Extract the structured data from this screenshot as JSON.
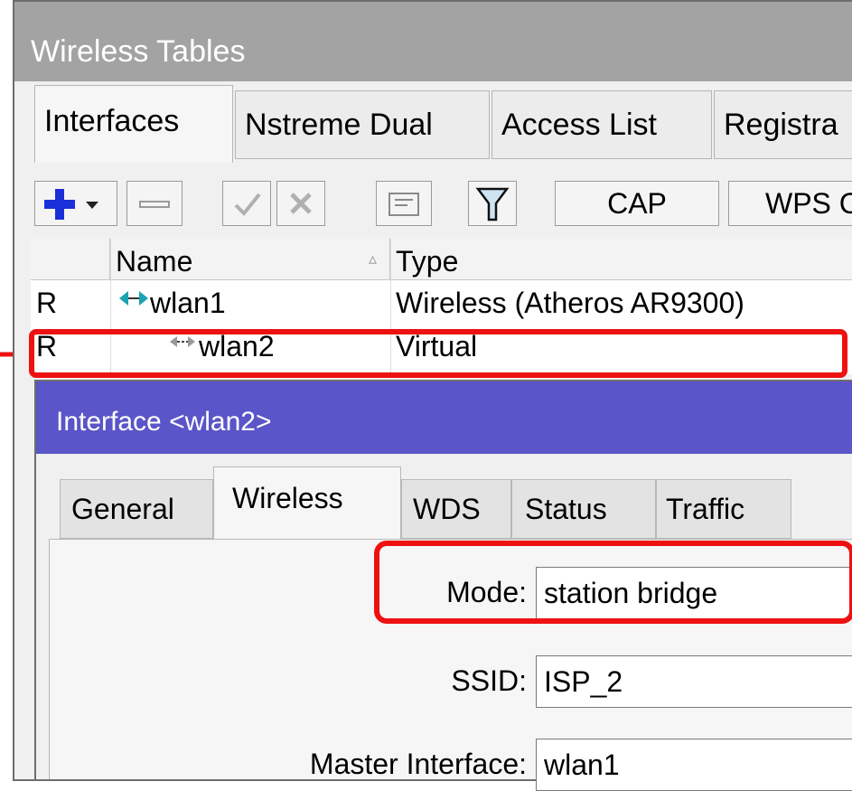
{
  "window": {
    "title": "Wireless Tables"
  },
  "tabs": [
    {
      "label": "Interfaces",
      "active": true
    },
    {
      "label": "Nstreme Dual",
      "active": false
    },
    {
      "label": "Access List",
      "active": false
    },
    {
      "label": "Registra",
      "active": false
    }
  ],
  "toolbar": {
    "add_icon": "plus-icon",
    "remove_icon": "minus-icon",
    "enable_icon": "check-icon",
    "disable_icon": "cross-icon",
    "comment_icon": "comment-icon",
    "filter_icon": "filter-icon",
    "cap_label": "CAP",
    "wps_label": "WPS C"
  },
  "table": {
    "columns": [
      "",
      "Name",
      "Type"
    ],
    "sort_indicator": "▵",
    "rows": [
      {
        "flag": "R",
        "name": "wlan1",
        "type": "Wireless (Atheros AR9300)"
      },
      {
        "flag": "R",
        "name": "wlan2",
        "type": "Virtual"
      }
    ]
  },
  "dialog": {
    "title": "Interface <wlan2>",
    "tabs": [
      "General",
      "Wireless",
      "WDS",
      "Status",
      "Traffic"
    ],
    "active_tab": "Wireless",
    "fields": {
      "mode": {
        "label": "Mode:",
        "value": "station bridge"
      },
      "ssid": {
        "label": "SSID:",
        "value": "ISP_2"
      },
      "master": {
        "label": "Master Interface:",
        "value": "wlan1"
      }
    }
  },
  "colors": {
    "highlight": "#ee1111",
    "dialog_title": "#5a55c8",
    "window_title": "#a3a3a3"
  }
}
